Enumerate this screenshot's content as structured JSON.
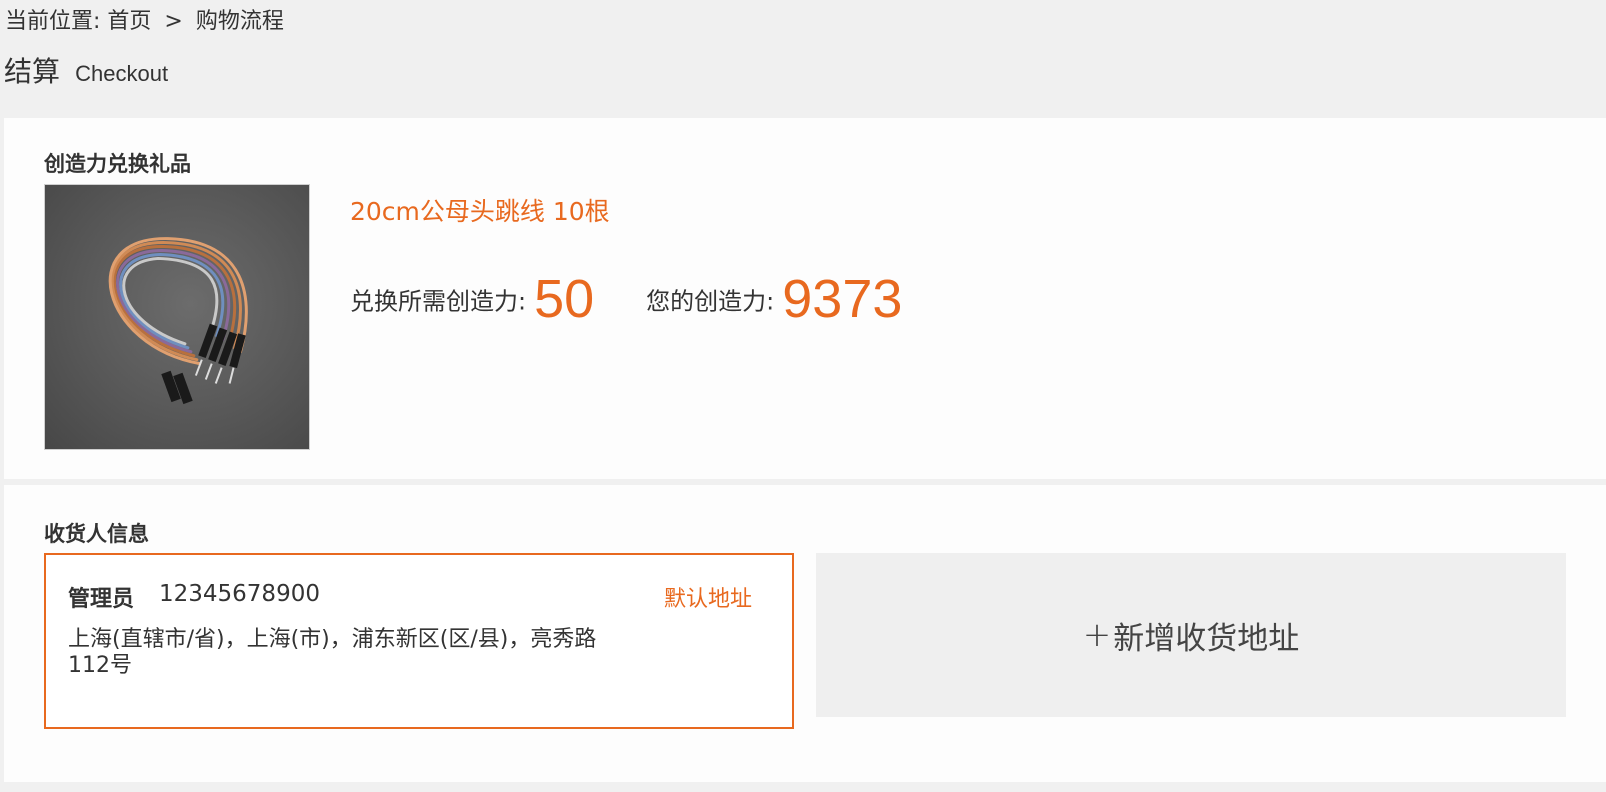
{
  "breadcrumb": {
    "prefix": "当前位置: ",
    "home": "首页",
    "separator": ">",
    "current": "购物流程"
  },
  "page_title": {
    "zh": "结算",
    "en": "Checkout"
  },
  "gift_section": {
    "heading": "创造力兑换礼品",
    "product": {
      "name": "20cm公母头跳线 10根",
      "image_icon": "jumper-wire-image"
    },
    "required_label": "兑换所需创造力:",
    "required_value": "50",
    "balance_label": "您的创造力:",
    "balance_value": "9373"
  },
  "address_section": {
    "heading": "收货人信息",
    "card": {
      "name": "管理员",
      "phone": "12345678900",
      "default_label": "默认地址",
      "address": "上海(直辖市/省)，上海(市)，浦东新区(区/县)，亮秀路112号"
    },
    "add_button": {
      "icon": "plus-icon",
      "plus": "+",
      "label": "新增收货地址"
    }
  },
  "colors": {
    "accent": "#e8691f",
    "text": "#333333",
    "page_bg": "#f0f0f0",
    "panel_bg": "#fdfdfd"
  }
}
